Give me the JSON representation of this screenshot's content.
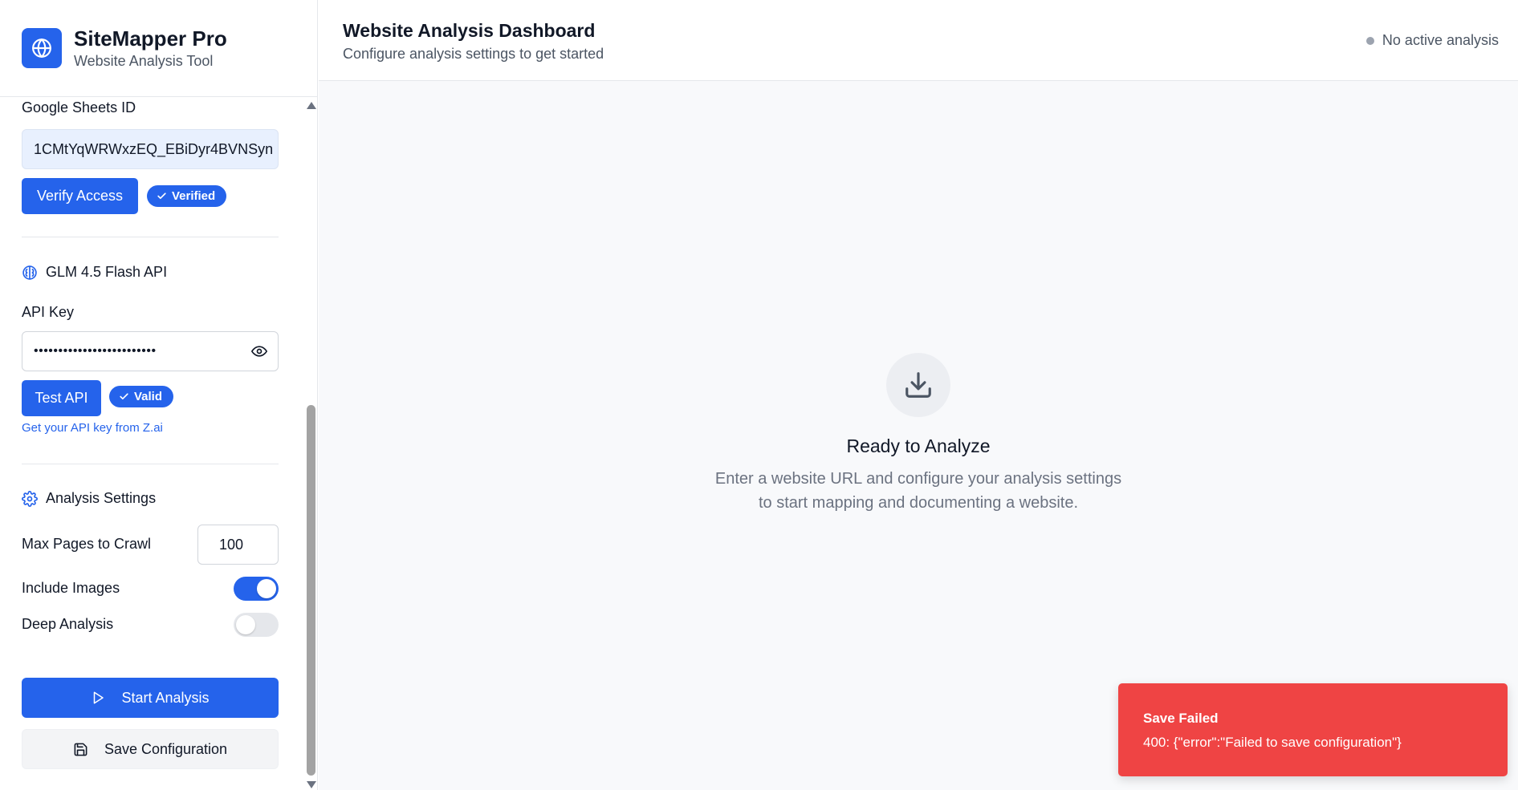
{
  "brand": {
    "name": "SiteMapper Pro",
    "subtitle": "Website Analysis Tool"
  },
  "sheets": {
    "label": "Google Sheets ID",
    "value": "1CMtYqWRWxzEQ_EBiDyr4BVNSyn",
    "verify_button": "Verify Access",
    "status_badge": "Verified"
  },
  "api": {
    "section_title": "GLM 4.5 Flash API",
    "key_label": "API Key",
    "key_value": "•••••••••••••••••••••••••",
    "test_button": "Test API",
    "status_badge": "Valid",
    "help_link": "Get your API key from Z.ai"
  },
  "settings": {
    "section_title": "Analysis Settings",
    "max_pages_label": "Max Pages to Crawl",
    "max_pages_value": "100",
    "include_images_label": "Include Images",
    "include_images_on": true,
    "deep_analysis_label": "Deep Analysis",
    "deep_analysis_on": false
  },
  "actions": {
    "start": "Start Analysis",
    "save": "Save Configuration"
  },
  "header": {
    "title": "Website Analysis Dashboard",
    "subtitle": "Configure analysis settings to get started",
    "status": "No active analysis"
  },
  "empty_state": {
    "title": "Ready to Analyze",
    "line1": "Enter a website URL and configure your analysis settings",
    "line2": "to start mapping and documenting a website."
  },
  "toast": {
    "title": "Save Failed",
    "message": "400: {\"error\":\"Failed to save configuration\"}"
  },
  "colors": {
    "accent": "#2563eb",
    "error": "#ef4444",
    "muted_text": "#6b7280"
  }
}
